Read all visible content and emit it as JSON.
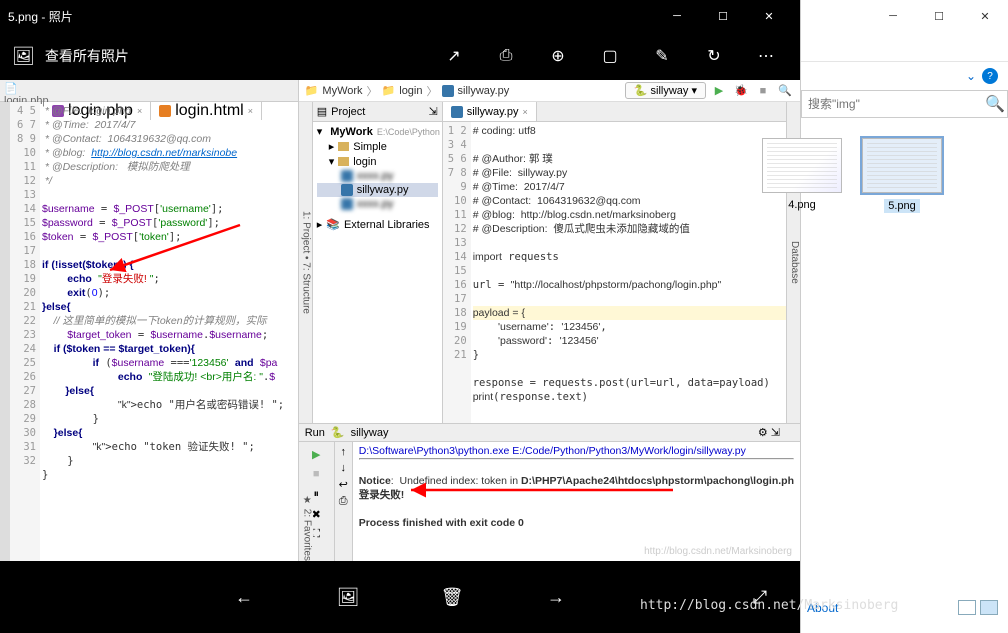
{
  "photos": {
    "title": "5.png - 照片",
    "view_all": "查看所有照片",
    "toolbar_icons": {
      "share": "↗",
      "print": "⎙",
      "zoom": "⊕",
      "slideshow": "▢",
      "edit": "✎",
      "rotate": "↻",
      "more": "⋯"
    },
    "bottom_icons": {
      "prev": "←",
      "collection": "🖼",
      "delete": "🗑",
      "next": "→",
      "fullscreen": "⤢"
    }
  },
  "left_ide": {
    "top_tab": "login.php",
    "tabs": [
      {
        "name": "login.php",
        "icon": "php",
        "active": true
      },
      {
        "name": "login.html",
        "icon": "html"
      }
    ],
    "line_start": 4,
    "line_end": 32,
    "code_lines": [
      {
        "t": " * @File:  login.php",
        "cls": "c"
      },
      {
        "t": " * @Time:  2017/4/7",
        "cls": "c"
      },
      {
        "t": " * @Contact:  1064319632@qq.com",
        "cls": "c"
      },
      {
        "t": " * @blog:  http://blog.csdn.net/marksinobe",
        "cls": "link"
      },
      {
        "t": " * @Description:   模拟防爬处理",
        "cls": "c"
      },
      {
        "t": " */",
        "cls": "c"
      },
      {
        "t": "",
        "cls": ""
      },
      {
        "t": "$username = $_POST['username'];",
        "cls": "mix1"
      },
      {
        "t": "$password = $_POST['password'];",
        "cls": "mix1"
      },
      {
        "t": "$token = $_POST['token'];",
        "cls": "mix1"
      },
      {
        "t": "",
        "cls": ""
      },
      {
        "t": "if (!isset($token)) {",
        "cls": "k"
      },
      {
        "t": "    echo \"登录失败! \";",
        "cls": "echo-red"
      },
      {
        "t": "    exit(0);",
        "cls": "mix2"
      },
      {
        "t": "}else{",
        "cls": "k"
      },
      {
        "t": "    // 这里简单的模拟一下token的计算规则，实际",
        "cls": "c"
      },
      {
        "t": "    $target_token = $username.$username;",
        "cls": "mix1"
      },
      {
        "t": "    if ($token == $target_token){",
        "cls": "k"
      },
      {
        "t": "        if ($username ==='123456' and $pa",
        "cls": "mix3"
      },
      {
        "t": "            echo \"登陆成功! <br>用户名: \".$",
        "cls": "echo-green"
      },
      {
        "t": "        }else{",
        "cls": "k"
      },
      {
        "t": "            echo \"用户名或密码错误! \";",
        "cls": "echo-red2"
      },
      {
        "t": "        }",
        "cls": ""
      },
      {
        "t": "    }else{",
        "cls": "k"
      },
      {
        "t": "        echo \"token 验证失败! \";",
        "cls": "echo-red2"
      },
      {
        "t": "    }",
        "cls": ""
      },
      {
        "t": "}",
        "cls": ""
      },
      {
        "t": "",
        "cls": ""
      },
      {
        "t": "",
        "cls": ""
      }
    ]
  },
  "right_ide": {
    "breadcrumb": [
      "MyWork",
      "login",
      "sillyway.py"
    ],
    "run_config": "sillyway",
    "project": {
      "header": "Project",
      "root": {
        "label": "MyWork",
        "hint": "E:\\Code\\Python"
      },
      "children": [
        {
          "label": "Simple",
          "depth": 1,
          "type": "folder"
        },
        {
          "label": "login",
          "depth": 1,
          "type": "folder",
          "open": true
        },
        {
          "label": "",
          "depth": 2,
          "type": "file",
          "blur": true
        },
        {
          "label": "sillyway.py",
          "depth": 2,
          "type": "py",
          "sel": true
        },
        {
          "label": "",
          "depth": 2,
          "type": "file",
          "blur": true
        }
      ],
      "ext_lib": "External Libraries"
    },
    "editor_tab": "sillyway.py",
    "py_line_start": 1,
    "py_line_end": 21,
    "py_lines": [
      "# coding: utf8",
      "",
      "# @Author: 郭 璞",
      "# @File:  sillyway.py",
      "# @Time:  2017/4/7",
      "# @Contact:  1064319632@qq.com",
      "# @blog:  http://blog.csdn.net/marksinoberg",
      "# @Description:  傻瓜式爬虫未添加隐藏域的值",
      "",
      "import requests",
      "",
      "url = \"http://localhost/phpstorm/pachong/login.php\"",
      "",
      "payload = {",
      "    'username': '123456',",
      "    'password': '123456'",
      "}",
      "",
      "response = requests.post(url=url, data=payload)",
      "print(response.text)",
      ""
    ],
    "run": {
      "label": "Run",
      "target": "sillyway",
      "lines": [
        "D:\\Software\\Python3\\python.exe E:/Code/Python/Python3/MyWork/login/sillyway.py",
        "<hr />",
        "<b>Notice</b>:  Undefined index: token in <b>D:\\PHP7\\Apache24\\htdocs\\phpstorm\\pachong\\login.ph",
        "登录失败!",
        "",
        "Process finished with exit code 0"
      ],
      "watermark": "http://blog.csdn.net/Marksinoberg"
    }
  },
  "explorer": {
    "search_placeholder": "搜索\"img\"",
    "help_icon": "?",
    "files": [
      {
        "name": "4.png",
        "partial": true
      },
      {
        "name": "5.png",
        "selected": true
      }
    ],
    "about": "About"
  },
  "watermark_global": "http://blog.csdn.net/Marksinoberg"
}
